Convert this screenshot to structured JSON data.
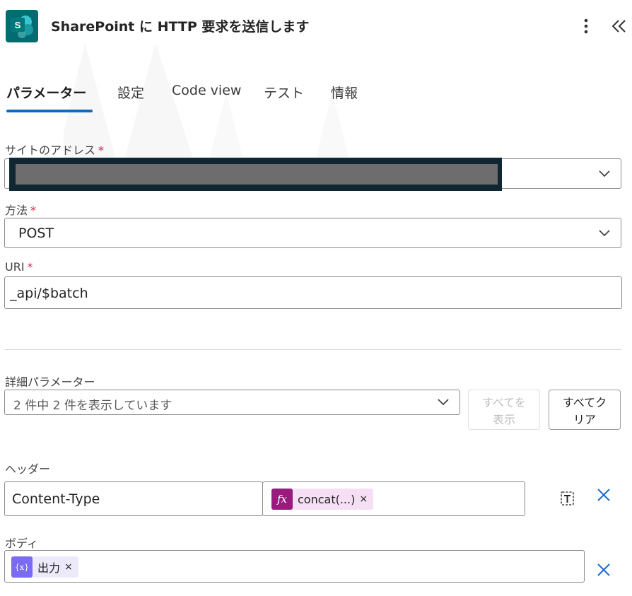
{
  "header": {
    "title": "SharePoint に HTTP 要求を送信します",
    "icon": "sharepoint-icon",
    "icon_letter": "S",
    "accent": "#036c70"
  },
  "tabs": [
    {
      "label": "パラメーター",
      "active": true
    },
    {
      "label": "設定",
      "active": false
    },
    {
      "label": "Code view",
      "active": false
    },
    {
      "label": "テスト",
      "active": false
    },
    {
      "label": "情報",
      "active": false
    }
  ],
  "fields": {
    "site": {
      "label": "サイトのアドレス",
      "required": "*"
    },
    "method": {
      "label": "方法",
      "required": "*",
      "value": "POST"
    },
    "uri": {
      "label": "URI",
      "required": "*",
      "value": "_api/$batch"
    }
  },
  "advanced": {
    "label": "詳細パラメーター",
    "value": "2 件中 2 件を表示しています",
    "show_all_line1": "すべてを",
    "show_all_line2": "表示",
    "clear_all_line1": "すべてク",
    "clear_all_line2": "リア"
  },
  "headers": {
    "label": "ヘッダー",
    "key": "Content-Type",
    "value_token": {
      "text": "concat(...)",
      "icon": "fx",
      "remove": "×"
    }
  },
  "body": {
    "label": "ボディ",
    "token": {
      "text": "出力",
      "icon": "{x}",
      "remove": "×"
    }
  },
  "colors": {
    "tab_underline": "#0f6cbd",
    "required": "#c4314b",
    "remove_x": "#1a6dd1",
    "fx_token_icon": "#981c7e",
    "var_token_icon": "#7a6bf0"
  }
}
